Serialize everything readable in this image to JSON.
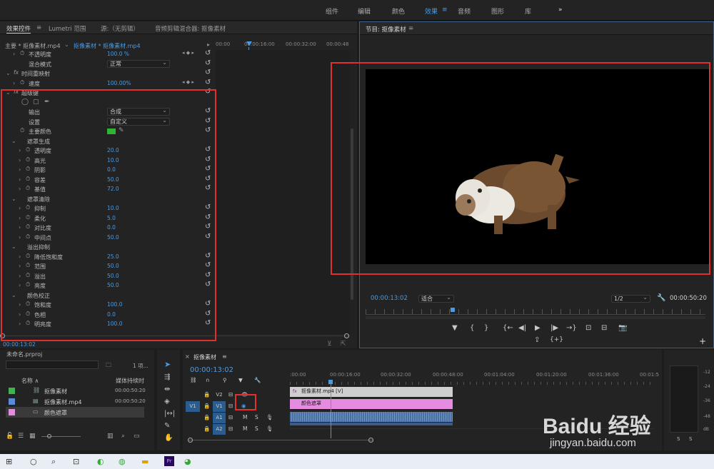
{
  "workspaces": [
    "组件",
    "编辑",
    "颜色",
    "效果",
    "音频",
    "图形",
    "库"
  ],
  "workspace_active": "效果",
  "workspace_more": "»",
  "effect_controls": {
    "tabs": [
      "效果控件",
      "Lumetri 范围",
      "源:（无剪辑）",
      "音频剪辑混合器: 抠像素材"
    ],
    "tab_menu": "≡",
    "clip_path": "主要 * 抠像素材.mp4",
    "clip_sel": "抠像素材 * 抠像素材.mp4",
    "ruler": [
      "00:00",
      "00:00:16:00",
      "00:00:32:00",
      "00:00:48"
    ],
    "timecode": "00:00:13:02",
    "rows": [
      {
        "label": "不透明度",
        "value": "100.0 %"
      },
      {
        "label": "混合模式",
        "dropdown": "正常"
      },
      {
        "label": "时间重映射",
        "section": true
      },
      {
        "label": "速度",
        "value": "100.00%"
      },
      {
        "label": "超级键",
        "section": true
      },
      {
        "label": "输出",
        "dropdown": "合成"
      },
      {
        "label": "设置",
        "dropdown": "自定义"
      },
      {
        "label": "主要颜色"
      },
      {
        "label": "遮罩生成",
        "section": true
      },
      {
        "label": "透明度",
        "value": "20.0"
      },
      {
        "label": "高光",
        "value": "10.0"
      },
      {
        "label": "阴影",
        "value": "0.0"
      },
      {
        "label": "容差",
        "value": "50.0"
      },
      {
        "label": "基值",
        "value": "72.0"
      },
      {
        "label": "遮罩清除",
        "section": true
      },
      {
        "label": "抑制",
        "value": "10.0"
      },
      {
        "label": "柔化",
        "value": "5.0"
      },
      {
        "label": "对比度",
        "value": "0.0"
      },
      {
        "label": "中间点",
        "value": "50.0"
      },
      {
        "label": "溢出抑制",
        "section": true
      },
      {
        "label": "降低饱和度",
        "value": "25.0"
      },
      {
        "label": "范围",
        "value": "50.0"
      },
      {
        "label": "溢出",
        "value": "50.0"
      },
      {
        "label": "亮度",
        "value": "50.0"
      },
      {
        "label": "颜色校正",
        "section": true
      },
      {
        "label": "饱和度",
        "value": "100.0"
      },
      {
        "label": "色相",
        "value": "0.0"
      },
      {
        "label": "明亮度",
        "value": "100.0"
      }
    ],
    "key_color": "#2fb52f"
  },
  "program": {
    "title": "节目: 抠像素材",
    "menu": "≡",
    "timecode": "00:00:13:02",
    "fit": "适合",
    "resolution": "1/2",
    "duration": "00:00:50:20",
    "controls": [
      "▼",
      "{",
      "}",
      "{←",
      "◀|",
      "▶",
      "|▶",
      "→}",
      "⊡",
      "⊟",
      "📷"
    ],
    "controls2": [
      "⇪",
      "{+}"
    ],
    "add": "+"
  },
  "project": {
    "title": "未命名.prproj",
    "count": "1 项...",
    "col_name": "名称 ∧",
    "col_dur": "媒体持续时",
    "items": [
      {
        "name": "抠像素材",
        "dur": "00:00:50:20",
        "color": "#3fb34f"
      },
      {
        "name": "抠像素材.mp4",
        "dur": "00:00:50:20",
        "color": "#5b8bd6"
      },
      {
        "name": "颜色遮罩",
        "dur": "",
        "color": "#e58be0"
      }
    ]
  },
  "timeline": {
    "title": "抠像素材",
    "menu": "≡",
    "timecode": "00:00:13:02",
    "ruler": [
      ":00:00",
      "00:00:16:00",
      "00:00:32:00",
      "00:00:48:00",
      "00:01:04:00",
      "00:01:20:00",
      "00:01:36:00",
      "00:01:5"
    ],
    "tracks": [
      {
        "name": "V2",
        "src": ""
      },
      {
        "name": "V1",
        "src": "V1"
      },
      {
        "name": "A1",
        "src": "A1"
      },
      {
        "name": "A2",
        "src": ""
      }
    ],
    "clip_v2": "抠像素材.mp4 [V]",
    "clip_v1": "颜色遮罩",
    "meter": [
      "-12",
      "-24",
      "-36",
      "-48",
      "dB"
    ],
    "solo": [
      "S",
      "S"
    ]
  },
  "watermark": {
    "brand": "Baidu 经验",
    "url": "jingyan.baidu.com"
  }
}
